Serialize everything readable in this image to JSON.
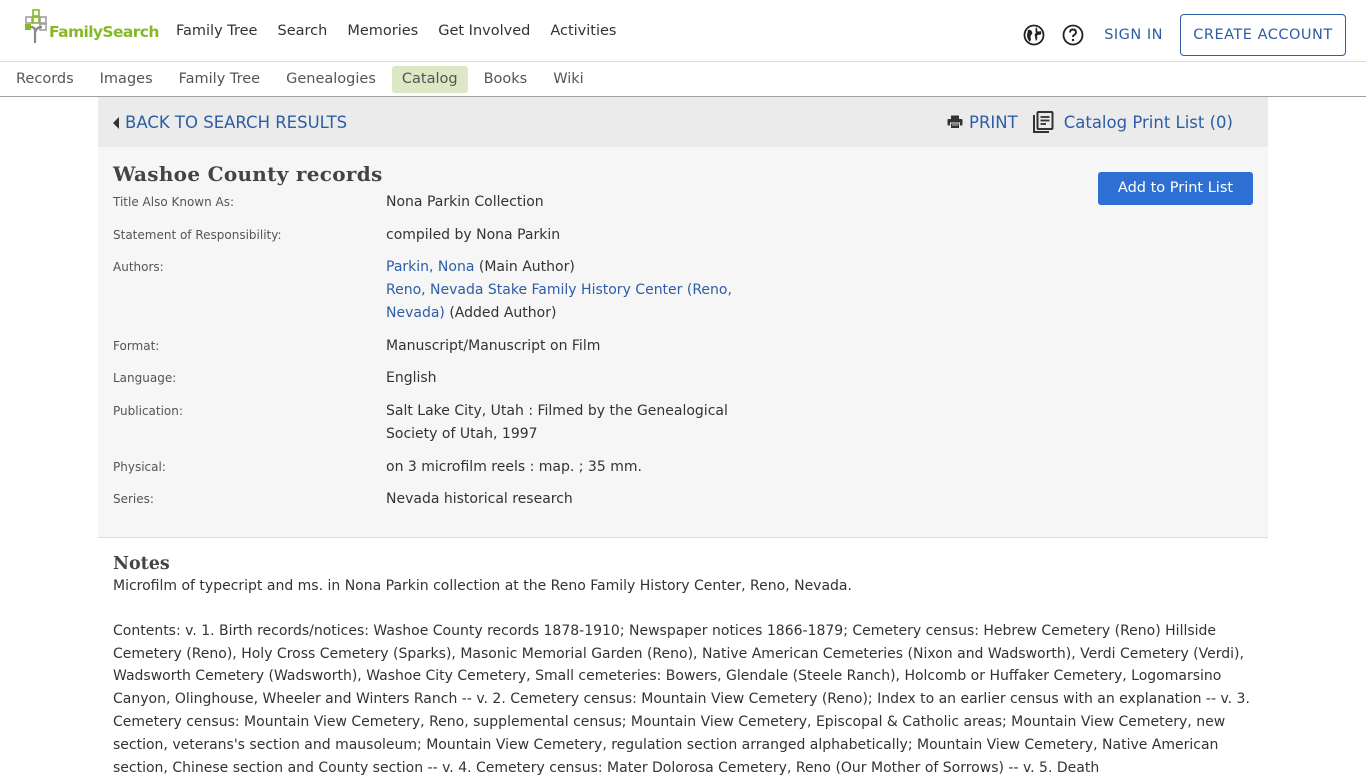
{
  "header": {
    "logo_text": "FamilySearch",
    "main_nav": [
      "Family Tree",
      "Search",
      "Memories",
      "Get Involved",
      "Activities"
    ],
    "language_icon": "globe-icon",
    "help_icon": "help-circle-icon",
    "sign_in_label": "SIGN IN",
    "create_account_label": "CREATE ACCOUNT"
  },
  "subnav": {
    "items": [
      {
        "label": "Records",
        "active": false
      },
      {
        "label": "Images",
        "active": false
      },
      {
        "label": "Family Tree",
        "active": false
      },
      {
        "label": "Genealogies",
        "active": false
      },
      {
        "label": "Catalog",
        "active": true
      },
      {
        "label": "Books",
        "active": false
      },
      {
        "label": "Wiki",
        "active": false
      }
    ],
    "active_color": "#dbe7c5"
  },
  "toolbar": {
    "back_label": "BACK TO SEARCH RESULTS",
    "print_label": "PRINT",
    "print_list_label": "Catalog Print List (0)"
  },
  "record": {
    "title": "Washoe County records",
    "add_button_label": "Add to Print List",
    "fields": {
      "title_also": {
        "label": "Title Also Known As:",
        "value": "Nona Parkin Collection"
      },
      "responsibility": {
        "label": "Statement of Responsibility:",
        "value": "compiled by Nona Parkin"
      },
      "authors": {
        "label": "Authors:",
        "items": [
          {
            "name": "Parkin, Nona",
            "role": " (Main Author)"
          },
          {
            "name": "Reno, Nevada Stake Family History Center (Reno, Nevada)",
            "role": " (Added Author)"
          }
        ]
      },
      "format": {
        "label": "Format:",
        "value": "Manuscript/Manuscript on Film"
      },
      "language": {
        "label": "Language:",
        "value": "English"
      },
      "publication": {
        "label": "Publication:",
        "value": "Salt Lake City, Utah : Filmed by the Genealogical Society of Utah, 1997"
      },
      "physical": {
        "label": "Physical:",
        "value": "on 3 microfilm reels : map. ; 35 mm."
      },
      "series": {
        "label": "Series:",
        "value": "Nevada historical research"
      }
    }
  },
  "notes": {
    "title": "Notes",
    "paragraph1": "Microfilm of typecript and ms. in Nona Parkin collection at the Reno Family History Center, Reno, Nevada.",
    "paragraph2": "Contents: v. 1. Birth records/notices: Washoe County records 1878-1910; Newspaper notices 1866-1879; Cemetery census: Hebrew Cemetery (Reno) Hillside Cemetery (Reno), Holy Cross Cemetery (Sparks), Masonic Memorial Garden (Reno), Native American Cemeteries (Nixon and Wadsworth), Verdi Cemetery (Verdi), Wadsworth Cemetery (Wadsworth), Washoe City Cemetery, Small cemeteries: Bowers, Glendale (Steele Ranch), Holcomb or Huffaker Cemetery, Logomarsino Canyon, Olinghouse, Wheeler and Winters Ranch -- v. 2. Cemetery census: Mountain View Cemetery (Reno); Index to an earlier census with an explanation -- v. 3. Cemetery census: Mountain View Cemetery, Reno, supplemental census; Mountain View Cemetery, Episcopal & Catholic areas; Mountain View Cemetery, new section, veterans's section and mausoleum; Mountain View Cemetery, regulation section arranged alphabetically; Mountain View Cemetery, Native American section, Chinese section and County section -- v. 4. Cemetery census: Mater Dolorosa Cemetery, Reno (Our Mother of Sorrows) -- v. 5. Death"
  },
  "colors": {
    "link": "#2e5da5",
    "primary_button": "#2e6fd4",
    "brand_green": "#87b828"
  }
}
